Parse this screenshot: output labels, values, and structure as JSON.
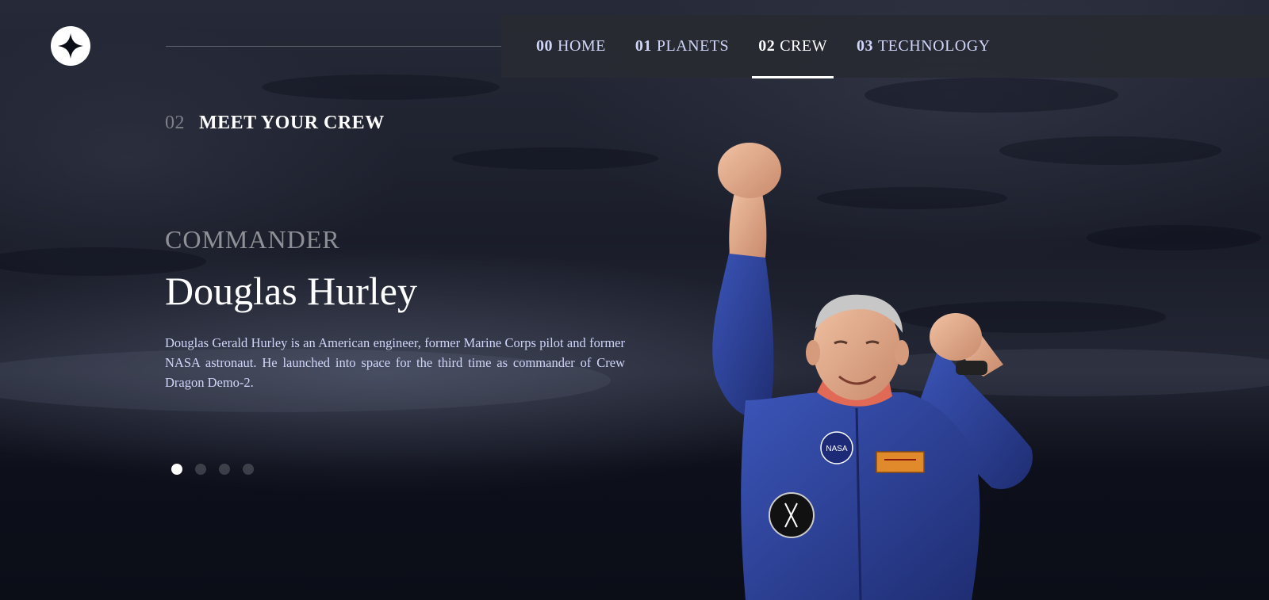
{
  "nav": {
    "items": [
      {
        "num": "00",
        "label": "HOME",
        "active": false
      },
      {
        "num": "01",
        "label": "PLANETS",
        "active": false
      },
      {
        "num": "02",
        "label": "CREW",
        "active": true
      },
      {
        "num": "03",
        "label": "TECHNOLOGY",
        "active": false
      }
    ]
  },
  "heading": {
    "num": "02",
    "text": "MEET YOUR CREW"
  },
  "crew": {
    "role": "COMMANDER",
    "name": "Douglas Hurley",
    "bio": "Douglas Gerald Hurley is an American engineer, former Marine Corps pilot and former NASA astronaut. He launched into space for the third time as commander of Crew Dragon Demo-2.",
    "badge_text": "NASA"
  },
  "slider": {
    "count": 4,
    "active_index": 0
  },
  "colors": {
    "background": "#0b0d17",
    "accent_text": "#d0d6f9",
    "suit_blue": "#2b3f95",
    "nav_bg": "#28292f"
  },
  "icons": {
    "logo": "star-logo-icon"
  }
}
